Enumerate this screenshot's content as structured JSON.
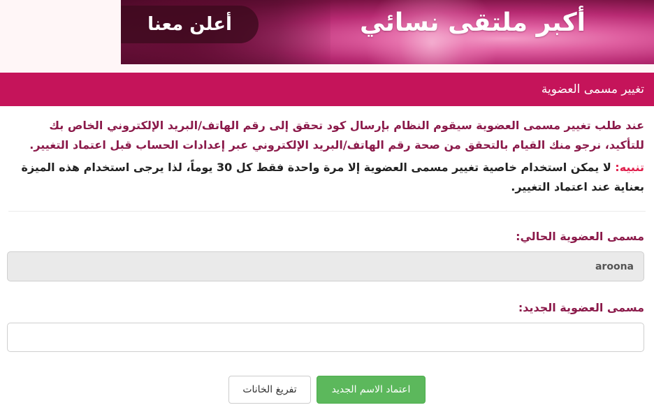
{
  "banner": {
    "headline": "أكبر ملتقى نسائي",
    "cta_label": "أعلن معنا"
  },
  "panel": {
    "title": "تغيير مسمى العضوية",
    "notice": "عند طلب تغيير مسمى العضوية سيقوم النظام بإرسال كود تحقق إلى رقم الهاتف/البريد الإلكتروني الخاص بك للتأكيد، نرجو منك القيام بالتحقق من صحة رقم الهاتف/البريد الإلكتروني عبر إعدادات الحساب قبل اعتماد التغيير.",
    "warning_label": "تنبيه:",
    "warning_text": " لا يمكن استخدام خاصية تغيير مسمى العضوية إلا مرة واحدة فقط كل 30 يوماً، لذا يرجى استخدام هذه الميزة بعناية عند اعتماد التغيير.",
    "current_label": "مسمى العضوية الحالي:",
    "current_value": "aroona",
    "new_label": "مسمى العضوية الجديد:",
    "new_value": "",
    "submit_label": "اعتماد الاسم الجديد",
    "reset_label": "تفريغ الخانات"
  }
}
